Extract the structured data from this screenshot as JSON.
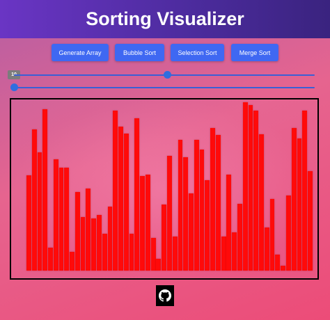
{
  "header": {
    "title": "Sorting Visualizer"
  },
  "toolbar": {
    "buttons": [
      {
        "label": "Generate Array"
      },
      {
        "label": "Bubble Sort"
      },
      {
        "label": "Selection Sort"
      },
      {
        "label": "Merge Sort"
      }
    ]
  },
  "controls": {
    "size_slider": {
      "value_label": "10",
      "level": 0.51
    },
    "speed_slider": {
      "level": 0.0
    }
  },
  "array": {
    "bar_color": "#ff0a0a",
    "values": [
      137,
      203,
      170,
      232,
      33,
      160,
      148,
      148,
      27,
      113,
      77,
      118,
      75,
      80,
      53,
      92,
      230,
      207,
      197,
      53,
      219,
      136,
      138,
      47,
      17,
      95,
      165,
      49,
      188,
      163,
      111,
      188,
      174,
      130,
      205,
      195,
      49,
      138,
      55,
      96,
      242,
      238,
      230,
      196,
      62,
      103,
      23,
      7,
      108,
      205,
      190,
      230,
      143
    ]
  },
  "footer": {
    "github_icon": "github-icon"
  }
}
